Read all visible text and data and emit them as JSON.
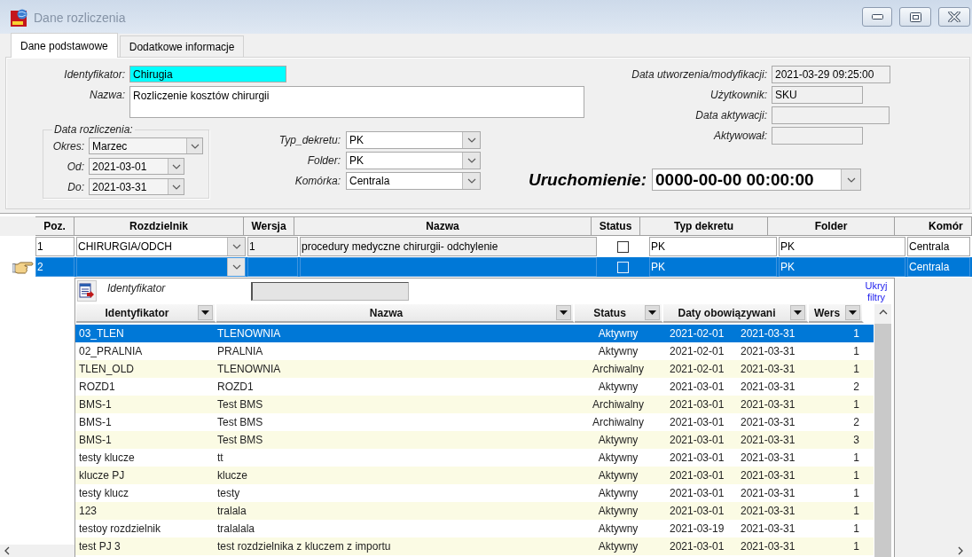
{
  "window": {
    "title": "Dane rozliczenia"
  },
  "tabs": [
    {
      "label": "Dane podstawowe",
      "selected": true
    },
    {
      "label": "Dodatkowe informacje",
      "selected": false
    }
  ],
  "form": {
    "identifier": {
      "label": "Identyfikator:",
      "value": "Chirugia"
    },
    "name": {
      "label": "Nazwa:",
      "value": "Rozliczenie kosztów chirurgii"
    },
    "settlement_period": {
      "legend": "Data rozliczenia:",
      "fields": [
        {
          "label": "Okres:",
          "value": "Marzec"
        },
        {
          "label": "Od:",
          "value": "2021-03-01"
        },
        {
          "label": "Do:",
          "value": "2021-03-31"
        }
      ]
    },
    "posting_fields": [
      {
        "label": "Typ_dekretu:",
        "value": "PK"
      },
      {
        "label": "Folder:",
        "value": "PK"
      },
      {
        "label": "Komórka:",
        "value": "Centrala"
      }
    ],
    "info_fields": [
      {
        "label": "Data utworzenia/modyfikacji:",
        "value": "2021-03-29 09:25:00"
      },
      {
        "label": "Użytkownik:",
        "value": "SKU"
      },
      {
        "label": "Data aktywacji:"
      },
      {
        "label": "Aktywował:"
      }
    ],
    "launch": {
      "label": "Uruchomienie:",
      "value": "0000-00-00 00:00:00"
    }
  },
  "grid": {
    "columns": [
      "Poz.",
      "Rozdzielnik",
      "Wersja",
      "Nazwa",
      "Status",
      "Typ dekretu",
      "Folder",
      "Komór"
    ],
    "rows": [
      {
        "selected": false,
        "poz": "1",
        "rozdzielnik": "CHIRURGIA/ODCH",
        "wersja": "1",
        "nazwa": "procedury medyczne chirurgii- odchylenie",
        "status_checked": false,
        "typ_dekretu": "PK",
        "folder": "PK",
        "komorka": "Centrala"
      },
      {
        "selected": true,
        "poz": "2",
        "status_checked": false,
        "typ_dekretu": "PK",
        "folder": "PK",
        "komorka": "Centrala"
      }
    ]
  },
  "lookup": {
    "filter_label": "Identyfikator",
    "hide_filters_link": "Ukryj filtry",
    "columns": [
      "Identyfikator",
      "Nazwa",
      "Status",
      "Daty obowiązywani",
      "Wers"
    ],
    "rows": [
      {
        "selected": true,
        "identyfikator": "03_TLEN",
        "nazwa": "TLENOWNIA",
        "status": "Aktywny",
        "valid_from": "2021-02-01",
        "valid_to": "2021-03-31",
        "wersja": "1"
      },
      {
        "selected": false,
        "identyfikator": "02_PRALNIA",
        "nazwa": "PRALNIA",
        "status": "Aktywny",
        "valid_from": "2021-02-01",
        "valid_to": "2021-03-31",
        "wersja": "1"
      },
      {
        "selected": false,
        "identyfikator": "TLEN_OLD",
        "nazwa": "TLENOWNIA",
        "status": "Archiwalny",
        "valid_from": "2021-02-01",
        "valid_to": "2021-03-31",
        "wersja": "1"
      },
      {
        "selected": false,
        "identyfikator": "ROZD1",
        "nazwa": "ROZD1",
        "status": "Aktywny",
        "valid_from": "2021-03-01",
        "valid_to": "2021-03-31",
        "wersja": "2"
      },
      {
        "selected": false,
        "identyfikator": "BMS-1",
        "nazwa": "Test BMS",
        "status": "Archiwalny",
        "valid_from": "2021-03-01",
        "valid_to": "2021-03-31",
        "wersja": "1"
      },
      {
        "selected": false,
        "identyfikator": "BMS-1",
        "nazwa": "Test BMS",
        "status": "Archiwalny",
        "valid_from": "2021-03-01",
        "valid_to": "2021-03-31",
        "wersja": "2"
      },
      {
        "selected": false,
        "identyfikator": "BMS-1",
        "nazwa": "Test BMS",
        "status": "Aktywny",
        "valid_from": "2021-03-01",
        "valid_to": "2021-03-31",
        "wersja": "3"
      },
      {
        "selected": false,
        "identyfikator": "testy klucze",
        "nazwa": "tt",
        "status": "Aktywny",
        "valid_from": "2021-03-01",
        "valid_to": "2021-03-31",
        "wersja": "1"
      },
      {
        "selected": false,
        "identyfikator": "klucze PJ",
        "nazwa": "klucze",
        "status": "Aktywny",
        "valid_from": "2021-03-01",
        "valid_to": "2021-03-31",
        "wersja": "1"
      },
      {
        "selected": false,
        "identyfikator": "testy klucz",
        "nazwa": "testy",
        "status": "Aktywny",
        "valid_from": "2021-03-01",
        "valid_to": "2021-03-31",
        "wersja": "1"
      },
      {
        "selected": false,
        "identyfikator": "123",
        "nazwa": "tralala",
        "status": "Aktywny",
        "valid_from": "2021-03-01",
        "valid_to": "2021-03-31",
        "wersja": "1"
      },
      {
        "selected": false,
        "identyfikator": "testoy rozdzielnik",
        "nazwa": "tralalala",
        "status": "Aktywny",
        "valid_from": "2021-03-19",
        "valid_to": "2021-03-31",
        "wersja": "1"
      },
      {
        "selected": false,
        "identyfikator": "test PJ 3",
        "nazwa": "test rozdzielnika z kluczem z importu",
        "status": "Aktywny",
        "valid_from": "2021-03-01",
        "valid_to": "2021-03-31",
        "wersja": "1"
      }
    ]
  }
}
